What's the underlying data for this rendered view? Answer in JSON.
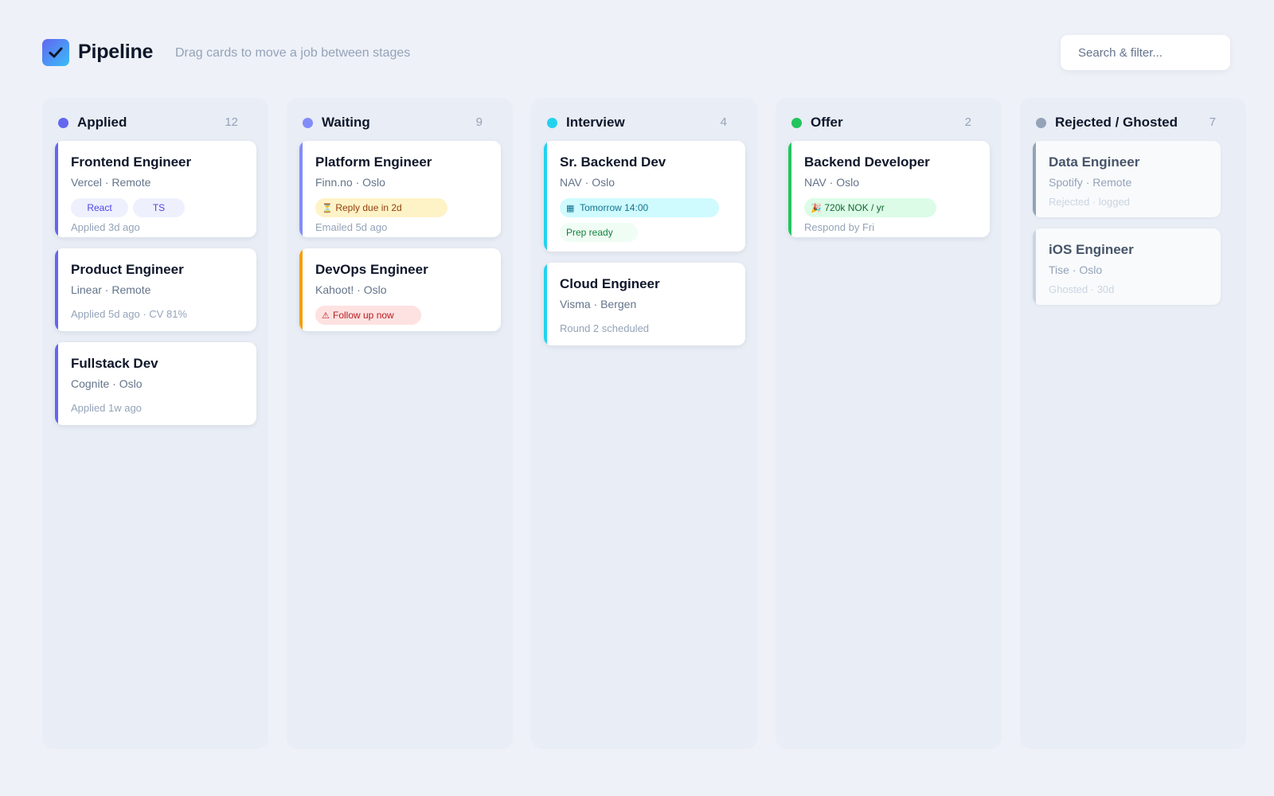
{
  "app": {
    "title": "Pipeline",
    "subtitle": "Drag cards to move a job between stages"
  },
  "search": {
    "placeholder": "Search & filter..."
  },
  "colors": {
    "applied": "#6366f1",
    "waiting": "#818cf8",
    "interview": "#22d3ee",
    "offer": "#22c55e",
    "rejected": "#94a3b8",
    "warning": "#f59e0b"
  },
  "columns": [
    {
      "title": "Applied",
      "count": "12",
      "cards": [
        {
          "title": "Frontend Engineer",
          "meta": "Vercel · Remote",
          "tags": [
            "React",
            "TS"
          ],
          "foot": "Applied 3d ago"
        },
        {
          "title": "Product Engineer",
          "meta": "Linear · Remote",
          "foot": "Applied 5d ago · CV 81%"
        },
        {
          "title": "Fullstack Dev",
          "meta": "Cognite · Oslo",
          "foot": "Applied 1w ago"
        }
      ]
    },
    {
      "title": "Waiting",
      "count": "9",
      "cards": [
        {
          "title": "Platform Engineer",
          "meta": "Finn.no · Oslo",
          "chip": "Reply due in 2d",
          "chip_icon": "hourglass-icon",
          "foot": "Emailed 5d ago"
        },
        {
          "title": "DevOps Engineer",
          "meta": "Kahoot! · Oslo",
          "chip": "Follow up now",
          "chip_icon": "warning-icon"
        }
      ]
    },
    {
      "title": "Interview",
      "count": "4",
      "cards": [
        {
          "title": "Sr. Backend Dev",
          "meta": "NAV · Oslo",
          "chip": "Tomorrow 14:00",
          "chip_icon": "calendar-icon",
          "chip2": "Prep ready"
        },
        {
          "title": "Cloud Engineer",
          "meta": "Visma · Bergen",
          "foot": "Round 2 scheduled"
        }
      ]
    },
    {
      "title": "Offer",
      "count": "2",
      "cards": [
        {
          "title": "Backend Developer",
          "meta": "NAV · Oslo",
          "chip": "720k NOK / yr",
          "chip_icon": "party-icon",
          "foot": "Respond by Fri"
        }
      ]
    },
    {
      "title": "Rejected / Ghosted",
      "count": "7",
      "cards": [
        {
          "title": "Data Engineer",
          "meta": "Spotify · Remote",
          "foot": "Rejected · logged"
        },
        {
          "title": "iOS Engineer",
          "meta": "Tise · Oslo",
          "foot": "Ghosted · 30d"
        }
      ]
    }
  ]
}
